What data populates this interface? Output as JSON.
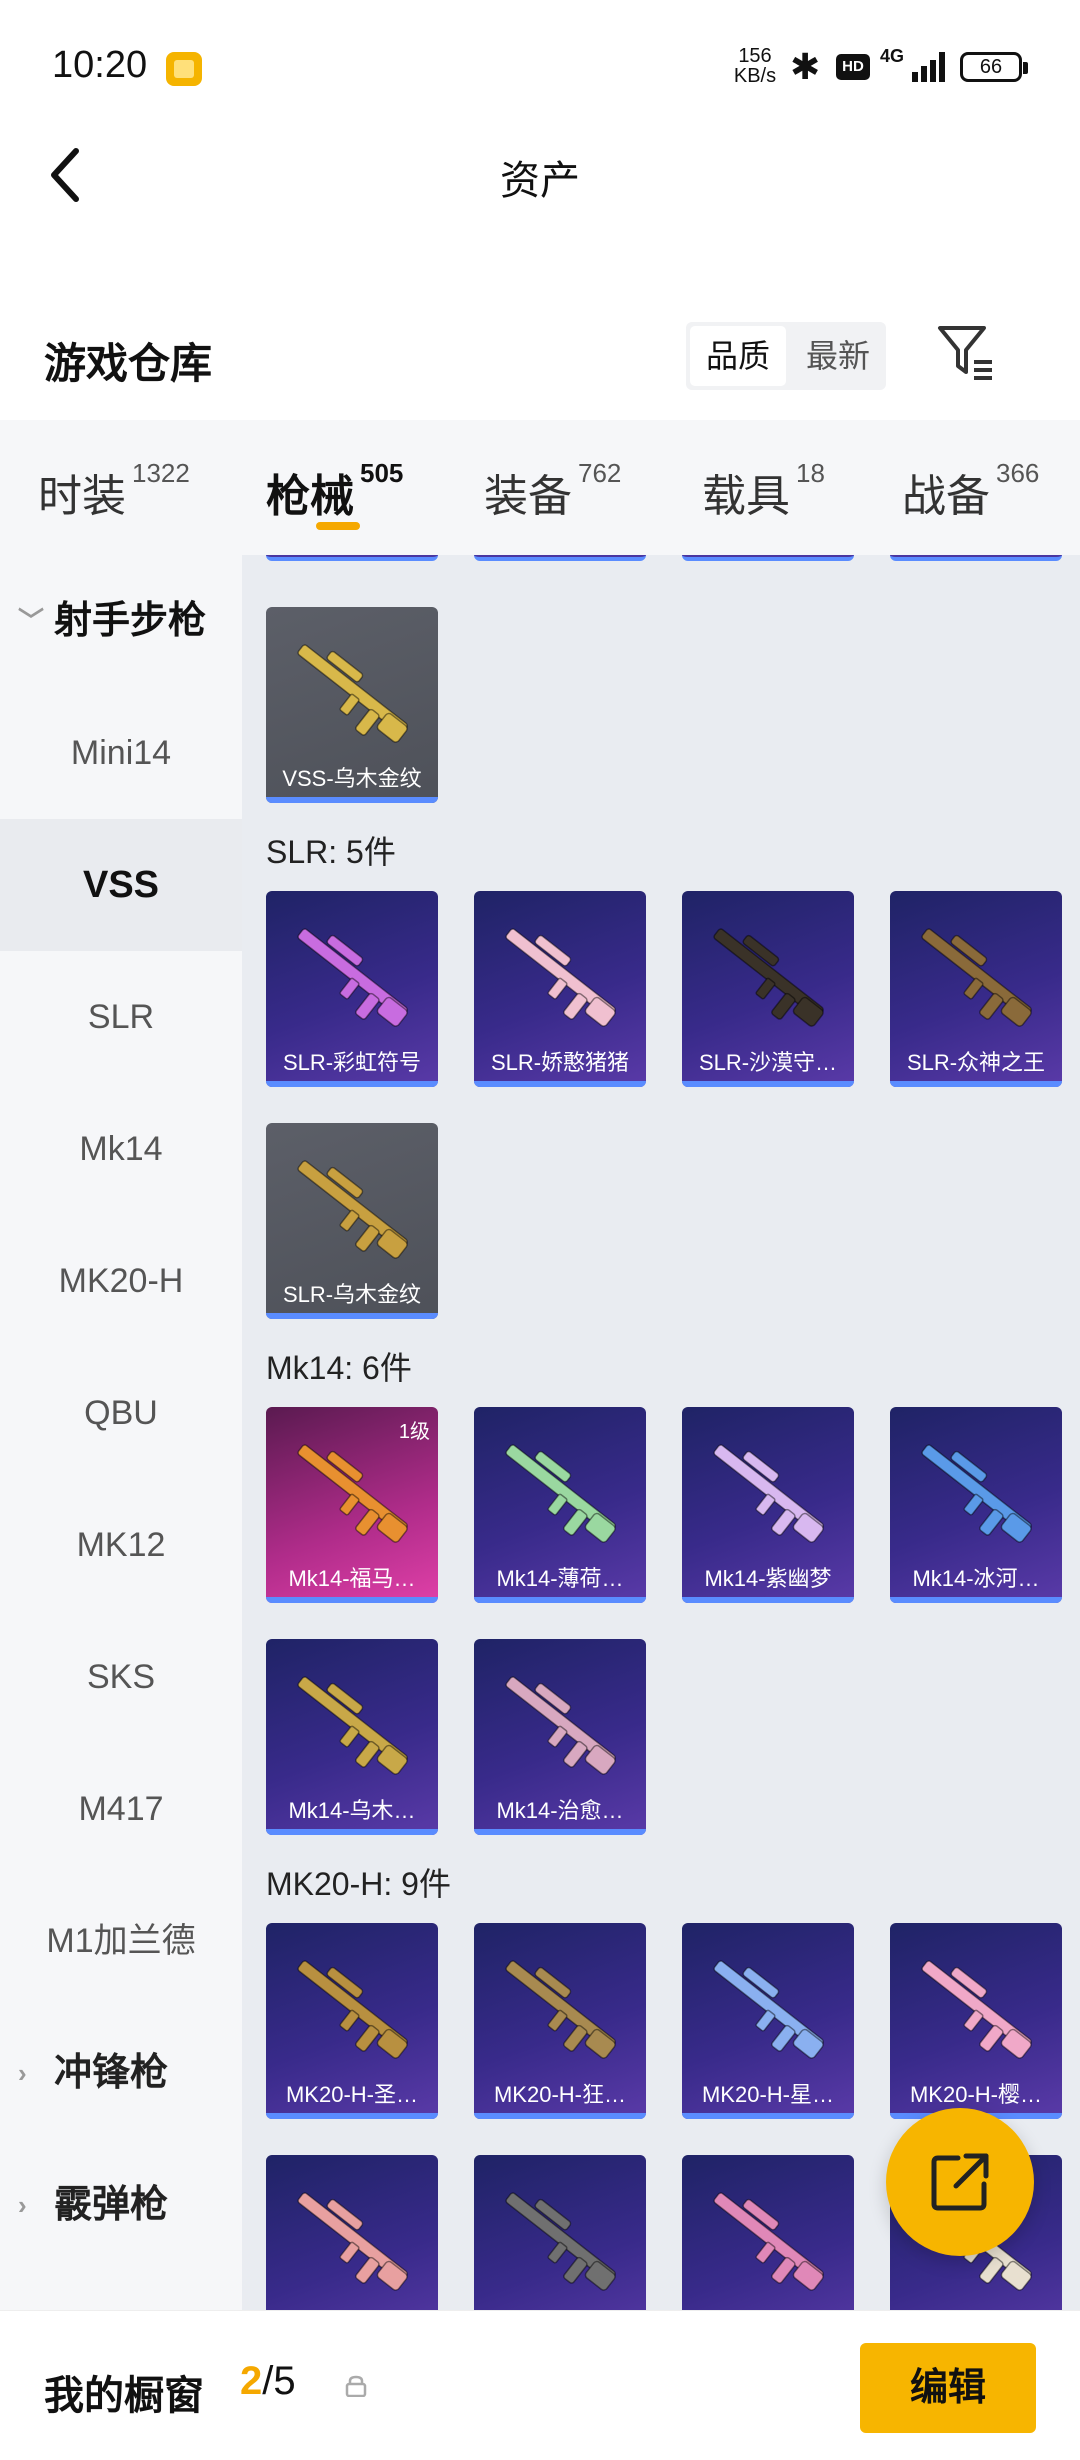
{
  "status_bar": {
    "time": "10:20",
    "net_speed_value": "156",
    "net_speed_unit": "KB/s",
    "hd": "HD",
    "network": "4G",
    "battery": "66"
  },
  "nav": {
    "title": "资产"
  },
  "warehouse": {
    "title": "游戏仓库",
    "sort_options": [
      "品质",
      "最新"
    ]
  },
  "tabs": [
    {
      "label": "时装",
      "count": "1322"
    },
    {
      "label": "枪械",
      "count": "505"
    },
    {
      "label": "装备",
      "count": "762"
    },
    {
      "label": "载具",
      "count": "18"
    },
    {
      "label": "战备",
      "count": "366"
    }
  ],
  "sidebar": {
    "group_open": "射手步枪",
    "items": [
      "Mini14",
      "VSS",
      "SLR",
      "Mk14",
      "MK20-H",
      "QBU",
      "MK12",
      "SKS",
      "M417",
      "M1加兰德"
    ],
    "groups_collapsed": [
      "冲锋枪",
      "霰弹枪"
    ]
  },
  "grid": {
    "vss_items": [
      "VSS-乌木金纹"
    ],
    "slr_title": "SLR: 5件",
    "slr_items": [
      "SLR-彩虹符号",
      "SLR-娇憨猪猪",
      "SLR-沙漠守…",
      "SLR-众神之王",
      "SLR-乌木金纹"
    ],
    "mk14_title": "Mk14: 6件",
    "mk14_items": [
      "Mk14-福马…",
      "Mk14-薄荷…",
      "Mk14-紫幽梦",
      "Mk14-冰河…",
      "Mk14-乌木…",
      "Mk14-治愈…"
    ],
    "mk14_level": "1级",
    "mk20_title": "MK20-H: 9件",
    "mk20_items": [
      "MK20-H-圣…",
      "MK20-H-狂…",
      "MK20-H-星…",
      "MK20-H-樱…"
    ]
  },
  "bottom": {
    "title": "我的橱窗",
    "current": "2",
    "total": "/5",
    "edit_label": "编辑"
  },
  "colors": {
    "accent": "#f7b500",
    "card_purple": "#382a8a",
    "card_gray": "#55585f",
    "card_pink": "#b02c8a"
  },
  "icons": [
    "back-arrow-icon",
    "filter-icon",
    "share-icon",
    "lock-icon",
    "chevron-down-icon",
    "chevron-right-icon",
    "bluetooth-icon",
    "signal-icon",
    "battery-icon"
  ]
}
